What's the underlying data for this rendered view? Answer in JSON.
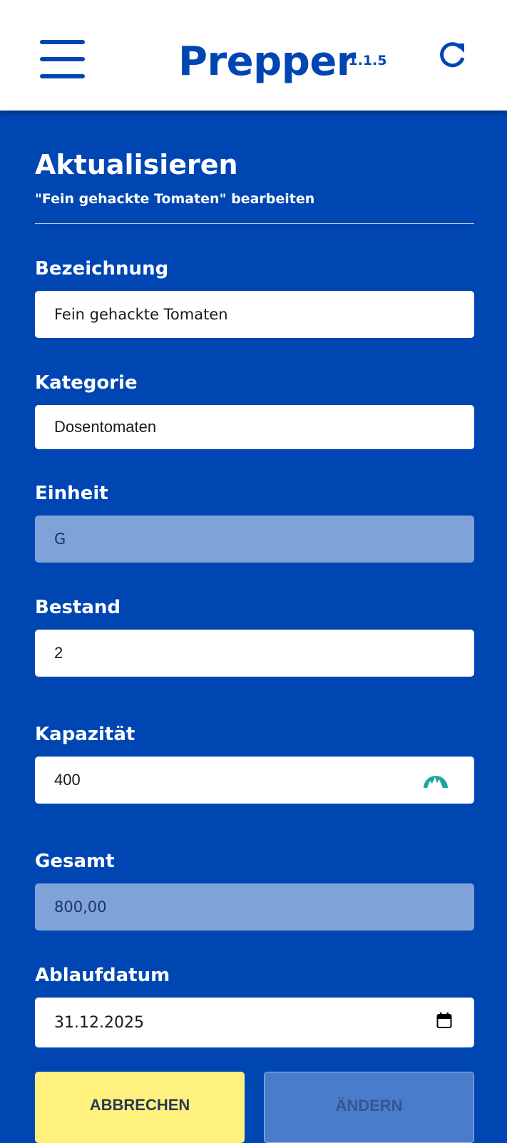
{
  "header": {
    "title": "Prepper",
    "version": "v1.1.5",
    "menu_icon": "hamburger-menu-icon",
    "refresh_icon": "refresh-icon"
  },
  "page": {
    "title": "Aktualisieren",
    "subtitle": "\"Fein gehackte Tomaten\" bearbeiten"
  },
  "form": {
    "bezeichnung": {
      "label": "Bezeichnung",
      "value": "Fein gehackte Tomaten"
    },
    "kategorie": {
      "label": "Kategorie",
      "value": "Dosentomaten"
    },
    "einheit": {
      "label": "Einheit",
      "value": "G"
    },
    "bestand": {
      "label": "Bestand",
      "value": "2"
    },
    "kapazitaet": {
      "label": "Kapazität",
      "value": "400",
      "icon": "mountain-badge-icon"
    },
    "gesamt": {
      "label": "Gesamt",
      "value": "800,00"
    },
    "ablaufdatum": {
      "label": "Ablaufdatum",
      "value": "31.12.2025",
      "icon": "calendar-icon"
    }
  },
  "buttons": {
    "cancel": "ABBRECHEN",
    "change": "ÄNDERN"
  },
  "colors": {
    "primary": "#0046b3",
    "header_bg": "#ffffff",
    "disabled_field": "#7fa3d9",
    "cancel_button": "#fff17e",
    "change_button": "#4a7ccc",
    "badge_icon": "#1aa7a0"
  }
}
